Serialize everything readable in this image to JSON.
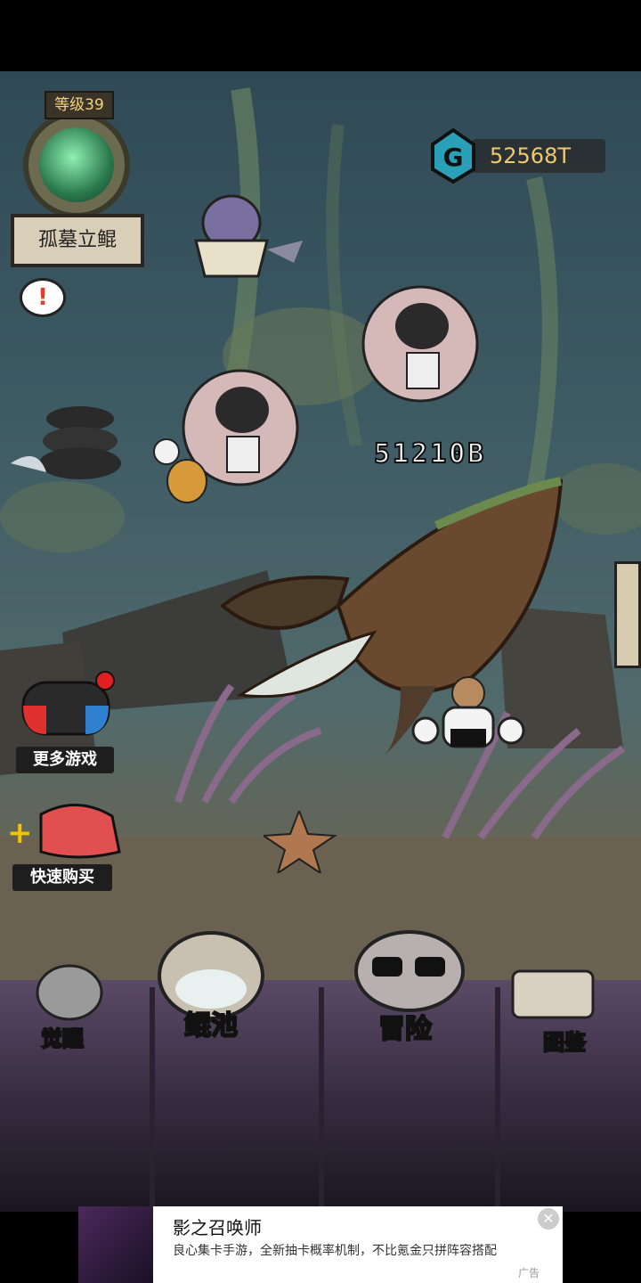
{
  "level": {
    "label": "等级39",
    "name": "孤墓立鲲"
  },
  "chat_icon": "exclamation-bubble-icon",
  "currency": {
    "value": "52568T",
    "icon": "currency-gem-icon"
  },
  "damage_number": "51210B",
  "side_buttons": {
    "more_games": "更多游戏",
    "quick_buy": "快速购买"
  },
  "nav": {
    "awaken": "觉醒",
    "kun_pool": "鲲池",
    "adventure": "冒险",
    "collection": "图鉴"
  },
  "ad": {
    "title": "影之召唤师",
    "description": "良心集卡手游，全新抽卡概率机制，不比氪金只拼阵容搭配",
    "tag": "广告",
    "close_icon": "close-icon"
  },
  "colors": {
    "currency": "#f2c96a",
    "level": "#f3d47a",
    "nav_bg": "#3a2f44"
  }
}
